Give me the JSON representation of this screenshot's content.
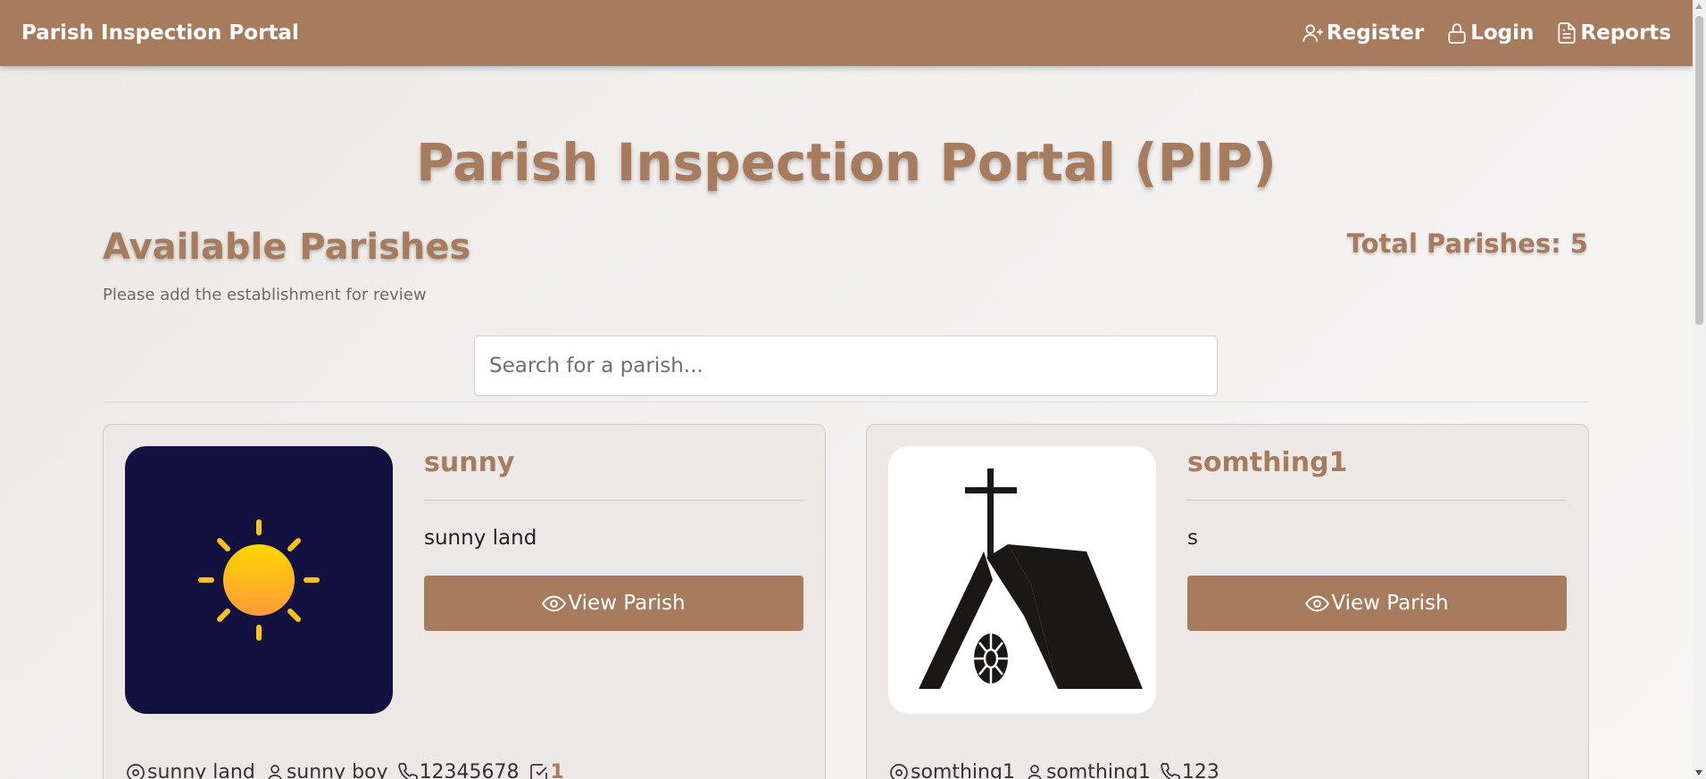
{
  "nav": {
    "brand": "Parish Inspection Portal",
    "links": [
      {
        "label": "Register",
        "icon": "user-plus-icon"
      },
      {
        "label": "Login",
        "icon": "lock-icon"
      },
      {
        "label": "Reports",
        "icon": "document-icon"
      }
    ]
  },
  "header": {
    "title": "Parish Inspection Portal (PIP)",
    "section_title": "Available Parishes",
    "subtitle": "Please add the establishment for review",
    "total_label": "Total Parishes: 5"
  },
  "search": {
    "placeholder": "Search for a parish..."
  },
  "parishes": [
    {
      "name": "sunny",
      "description": "sunny land",
      "button_label": "View Parish",
      "image": "sun-icon",
      "location": "sunny land",
      "contact": "sunny boy",
      "phone": "12345678",
      "inspections": "1"
    },
    {
      "name": "somthing1",
      "description": "s",
      "button_label": "View Parish",
      "image": "church-icon",
      "location": "somthing1",
      "contact": "somthing1",
      "phone": "123"
    }
  ],
  "colors": {
    "brand": "#a77c5e",
    "card_bg": "#ece8e5",
    "sun_bg": "#12113f",
    "sun": "#ffb02e"
  }
}
